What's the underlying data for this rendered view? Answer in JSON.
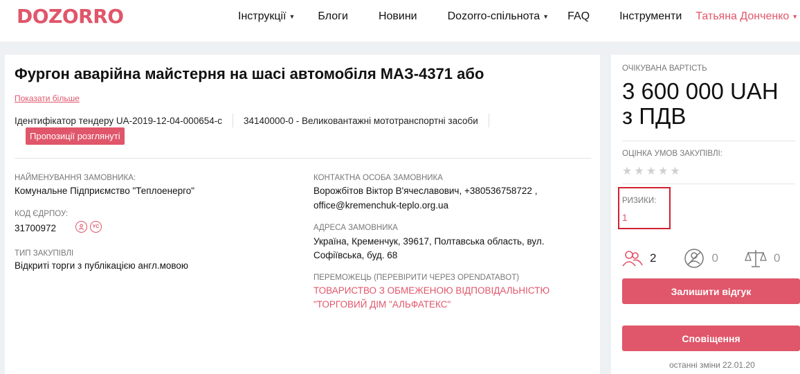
{
  "header": {
    "logo": "DOZORRO",
    "nav": [
      {
        "label": "Інструкції",
        "has_dropdown": true
      },
      {
        "label": "Блоги",
        "has_dropdown": false
      },
      {
        "label": "Новини",
        "has_dropdown": false
      },
      {
        "label": "Dozorro-спільнота",
        "has_dropdown": true
      },
      {
        "label": "FAQ",
        "has_dropdown": false
      },
      {
        "label": "Інструменти",
        "has_dropdown": false
      }
    ],
    "user": "Татьяна Донченко",
    "user_dropdown_icon": "chevron-down-icon"
  },
  "tender": {
    "title": "Фургон аварійна майстерня на шасі автомобіля МАЗ-4371 або",
    "show_more": "Показати більше",
    "identifier": "Ідентифікатор тендеру UA-2019-12-04-000654-c",
    "cpv": "34140000-0 - Великовантажні мототранспортні засоби",
    "status_badge": "Пропозиції розглянуті"
  },
  "customer": {
    "name_label": "НАЙМЕНУВАННЯ ЗАМОВНИКА:",
    "name": "Комунальне Підприємство \"Теплоенерго\"",
    "edrpou_label": "КОД ЄДРПОУ:",
    "edrpou": "31700972",
    "edrpou_icons": [
      "person-icon",
      "yc-icon"
    ],
    "procurement_type_label": "ТИП ЗАКУПІВЛІ",
    "procurement_type": "Відкриті торги з публікацією англ.мовою",
    "contact_label": "КОНТАКТНА ОСОБА ЗАМОВНИКА",
    "contact_line1": "Ворожбітов Віктор В'ячеславович, +380536758722 ,",
    "contact_line2": "office@kremenchuk-teplo.org.ua",
    "address_label": "АДРЕСА ЗАМОВНИКА",
    "address_line1": "Україна, Кременчук, 39617, Полтавська область, вул.",
    "address_line2": "Софіївська, буд. 68",
    "winner_label": "ПЕРЕМОЖЕЦЬ (ПЕРЕВІРИТИ ЧЕРЕЗ OPENDATABOT)",
    "winner_line1": "ТОВАРИСТВО З ОБМЕЖЕНОЮ ВІДПОВІДАЛЬНІСТЮ",
    "winner_line2": "\"ТОРГОВИЙ ДІМ \"АЛЬФАТЕКС\""
  },
  "sidebar": {
    "expected_value_label": "ОЧІКУВАНА ВАРТІСТЬ",
    "expected_value_line1": "3 600 000 UAH",
    "expected_value_line2": "з ПДВ",
    "rating_label": "ОЦІНКА УМОВ ЗАКУПІВЛІ:",
    "rating": 0,
    "rating_max": 5,
    "risks_label": "РИЗИКИ:",
    "risks_value": "1",
    "stats": [
      {
        "icon": "users-icon",
        "value": "2"
      },
      {
        "icon": "no-user-icon",
        "value": "0"
      },
      {
        "icon": "scales-icon",
        "value": "0"
      }
    ],
    "feedback_button": "Залишити відгук",
    "notify_button": "Сповіщення",
    "last_change": "останні зміни 22.01.20"
  },
  "colors": {
    "accent": "#e0566a",
    "risk_highlight": "#d02030",
    "page_bg": "#eef1f3"
  }
}
